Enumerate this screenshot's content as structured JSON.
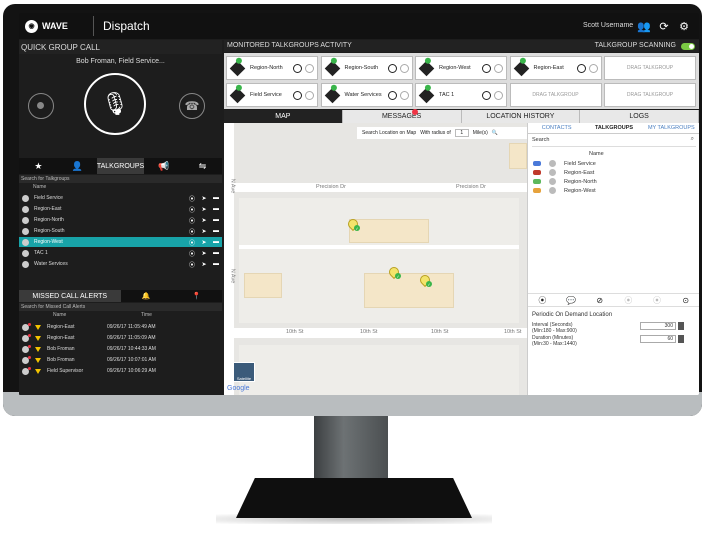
{
  "app": {
    "brand": "WAVE",
    "title": "Dispatch",
    "username": "Scott Username"
  },
  "quick_group_call": {
    "header": "QUICK GROUP CALL",
    "caller": "Bob Froman, Field Service..."
  },
  "talkgroups_panel": {
    "tab_label": "TALKGROUPS",
    "search_placeholder": "Search for Talkgroups",
    "name_header": "Name",
    "rows": [
      {
        "name": "Field Service",
        "selected": false
      },
      {
        "name": "Region-East",
        "selected": false
      },
      {
        "name": "Region-North",
        "selected": false
      },
      {
        "name": "Region-South",
        "selected": false
      },
      {
        "name": "Region-West",
        "selected": true
      },
      {
        "name": "TAC 1",
        "selected": false
      },
      {
        "name": "Water Services",
        "selected": false
      }
    ]
  },
  "missed_call_alerts": {
    "tab_label": "MISSED CALL ALERTS",
    "search_placeholder": "Search for Missed Call Alerts",
    "name_header": "Name",
    "time_header": "Time",
    "rows": [
      {
        "name": "Region-East",
        "time": "09/26/17 11:05:49 AM"
      },
      {
        "name": "Region-East",
        "time": "09/26/17 11:05:09 AM"
      },
      {
        "name": "Bob Froman",
        "time": "09/26/17 10:44:33 AM"
      },
      {
        "name": "Bob Froman",
        "time": "09/26/17 10:07:01 AM"
      },
      {
        "name": "Field Supervisor",
        "time": "09/26/17 10:06:29 AM"
      }
    ]
  },
  "monitored": {
    "header": "MONITORED TALKGROUPS ACTIVITY",
    "scanning_label": "TALKGROUP SCANNING",
    "cards": [
      "Region-North",
      "Region-South",
      "Region-West",
      "Region-East",
      "DRAG TALKGROUP",
      "Field Service",
      "Water Services",
      "TAC 1",
      "DRAG TALKGROUP",
      "DRAG TALKGROUP"
    ]
  },
  "main_tabs": {
    "map": "MAP",
    "messages": "MESSAGES",
    "location_history": "LOCATION HISTORY",
    "logs": "LOGS"
  },
  "map": {
    "search_label": "Search Location on Map",
    "radius_label": "With radius of",
    "radius_value": "1",
    "unit_label": "Mile(s)",
    "streets": [
      "Precision Dr",
      "Precision Dr",
      "10th St",
      "10th St",
      "10th St",
      "10th St",
      "N Ave",
      "N Ave"
    ],
    "satellite_label": "Satellite",
    "google_label": "Google"
  },
  "right_panel": {
    "tabs": [
      "CONTACTS",
      "TALKGROUPS",
      "MY TALKGROUPS"
    ],
    "search_label": "Search",
    "name_header": "Name",
    "rows": [
      {
        "name": "Field Service",
        "color": "#4a79d9"
      },
      {
        "name": "Region-East",
        "color": "#c0392b"
      },
      {
        "name": "Region-North",
        "color": "#5cb85c"
      },
      {
        "name": "Region-West",
        "color": "#e6a23c"
      }
    ],
    "pod_title": "Periodic On Demand Location",
    "interval_label": "Interval (Seconds)",
    "interval_range": "(Min:180 - Max:900)",
    "interval_value": "300",
    "duration_label": "Duration (Minutes)",
    "duration_range": "(Min:30 - Max:1440)",
    "duration_value": "60"
  }
}
